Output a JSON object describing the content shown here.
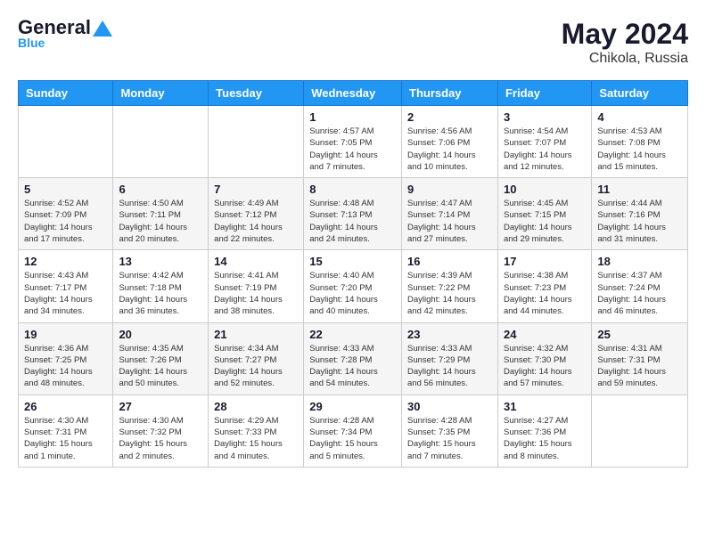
{
  "header": {
    "logo_general": "General",
    "logo_blue": "Blue",
    "month_year": "May 2024",
    "location": "Chikola, Russia"
  },
  "days_of_week": [
    "Sunday",
    "Monday",
    "Tuesday",
    "Wednesday",
    "Thursday",
    "Friday",
    "Saturday"
  ],
  "weeks": [
    [
      {
        "num": "",
        "info": ""
      },
      {
        "num": "",
        "info": ""
      },
      {
        "num": "",
        "info": ""
      },
      {
        "num": "1",
        "info": "Sunrise: 4:57 AM\nSunset: 7:05 PM\nDaylight: 14 hours\nand 7 minutes."
      },
      {
        "num": "2",
        "info": "Sunrise: 4:56 AM\nSunset: 7:06 PM\nDaylight: 14 hours\nand 10 minutes."
      },
      {
        "num": "3",
        "info": "Sunrise: 4:54 AM\nSunset: 7:07 PM\nDaylight: 14 hours\nand 12 minutes."
      },
      {
        "num": "4",
        "info": "Sunrise: 4:53 AM\nSunset: 7:08 PM\nDaylight: 14 hours\nand 15 minutes."
      }
    ],
    [
      {
        "num": "5",
        "info": "Sunrise: 4:52 AM\nSunset: 7:09 PM\nDaylight: 14 hours\nand 17 minutes."
      },
      {
        "num": "6",
        "info": "Sunrise: 4:50 AM\nSunset: 7:11 PM\nDaylight: 14 hours\nand 20 minutes."
      },
      {
        "num": "7",
        "info": "Sunrise: 4:49 AM\nSunset: 7:12 PM\nDaylight: 14 hours\nand 22 minutes."
      },
      {
        "num": "8",
        "info": "Sunrise: 4:48 AM\nSunset: 7:13 PM\nDaylight: 14 hours\nand 24 minutes."
      },
      {
        "num": "9",
        "info": "Sunrise: 4:47 AM\nSunset: 7:14 PM\nDaylight: 14 hours\nand 27 minutes."
      },
      {
        "num": "10",
        "info": "Sunrise: 4:45 AM\nSunset: 7:15 PM\nDaylight: 14 hours\nand 29 minutes."
      },
      {
        "num": "11",
        "info": "Sunrise: 4:44 AM\nSunset: 7:16 PM\nDaylight: 14 hours\nand 31 minutes."
      }
    ],
    [
      {
        "num": "12",
        "info": "Sunrise: 4:43 AM\nSunset: 7:17 PM\nDaylight: 14 hours\nand 34 minutes."
      },
      {
        "num": "13",
        "info": "Sunrise: 4:42 AM\nSunset: 7:18 PM\nDaylight: 14 hours\nand 36 minutes."
      },
      {
        "num": "14",
        "info": "Sunrise: 4:41 AM\nSunset: 7:19 PM\nDaylight: 14 hours\nand 38 minutes."
      },
      {
        "num": "15",
        "info": "Sunrise: 4:40 AM\nSunset: 7:20 PM\nDaylight: 14 hours\nand 40 minutes."
      },
      {
        "num": "16",
        "info": "Sunrise: 4:39 AM\nSunset: 7:22 PM\nDaylight: 14 hours\nand 42 minutes."
      },
      {
        "num": "17",
        "info": "Sunrise: 4:38 AM\nSunset: 7:23 PM\nDaylight: 14 hours\nand 44 minutes."
      },
      {
        "num": "18",
        "info": "Sunrise: 4:37 AM\nSunset: 7:24 PM\nDaylight: 14 hours\nand 46 minutes."
      }
    ],
    [
      {
        "num": "19",
        "info": "Sunrise: 4:36 AM\nSunset: 7:25 PM\nDaylight: 14 hours\nand 48 minutes."
      },
      {
        "num": "20",
        "info": "Sunrise: 4:35 AM\nSunset: 7:26 PM\nDaylight: 14 hours\nand 50 minutes."
      },
      {
        "num": "21",
        "info": "Sunrise: 4:34 AM\nSunset: 7:27 PM\nDaylight: 14 hours\nand 52 minutes."
      },
      {
        "num": "22",
        "info": "Sunrise: 4:33 AM\nSunset: 7:28 PM\nDaylight: 14 hours\nand 54 minutes."
      },
      {
        "num": "23",
        "info": "Sunrise: 4:33 AM\nSunset: 7:29 PM\nDaylight: 14 hours\nand 56 minutes."
      },
      {
        "num": "24",
        "info": "Sunrise: 4:32 AM\nSunset: 7:30 PM\nDaylight: 14 hours\nand 57 minutes."
      },
      {
        "num": "25",
        "info": "Sunrise: 4:31 AM\nSunset: 7:31 PM\nDaylight: 14 hours\nand 59 minutes."
      }
    ],
    [
      {
        "num": "26",
        "info": "Sunrise: 4:30 AM\nSunset: 7:31 PM\nDaylight: 15 hours\nand 1 minute."
      },
      {
        "num": "27",
        "info": "Sunrise: 4:30 AM\nSunset: 7:32 PM\nDaylight: 15 hours\nand 2 minutes."
      },
      {
        "num": "28",
        "info": "Sunrise: 4:29 AM\nSunset: 7:33 PM\nDaylight: 15 hours\nand 4 minutes."
      },
      {
        "num": "29",
        "info": "Sunrise: 4:28 AM\nSunset: 7:34 PM\nDaylight: 15 hours\nand 5 minutes."
      },
      {
        "num": "30",
        "info": "Sunrise: 4:28 AM\nSunset: 7:35 PM\nDaylight: 15 hours\nand 7 minutes."
      },
      {
        "num": "31",
        "info": "Sunrise: 4:27 AM\nSunset: 7:36 PM\nDaylight: 15 hours\nand 8 minutes."
      },
      {
        "num": "",
        "info": ""
      }
    ]
  ]
}
